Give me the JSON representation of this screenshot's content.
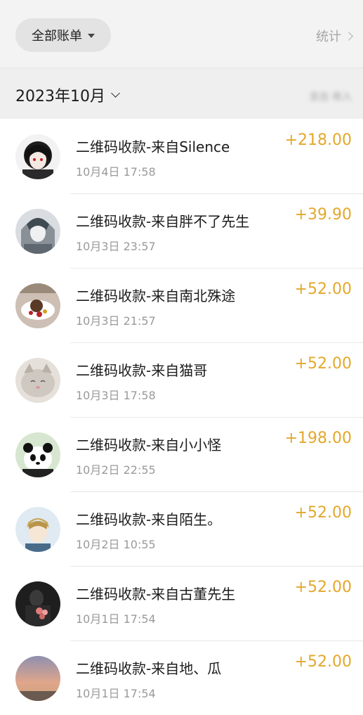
{
  "header": {
    "filter_label": "全部账单",
    "stats_label": "统计"
  },
  "month_bar": {
    "month_label": "2023年10月",
    "summary_text": "支出 收入"
  },
  "transactions": [
    {
      "title": "二维码收款-来自Silence",
      "time": "10月4日 17:58",
      "amount": "+218.00",
      "avatar": "anime-girl-avatar"
    },
    {
      "title": "二维码收款-来自胖不了先生",
      "time": "10月3日 23:57",
      "amount": "+39.90",
      "avatar": "anime-character-avatar"
    },
    {
      "title": "二维码收款-来自南北殊途",
      "time": "10月3日 21:57",
      "amount": "+52.00",
      "avatar": "dessert-plate-avatar"
    },
    {
      "title": "二维码收款-来自猫哥",
      "time": "10月3日 17:58",
      "amount": "+52.00",
      "avatar": "cat-avatar"
    },
    {
      "title": "二维码收款-来自小小怪",
      "time": "10月2日 22:55",
      "amount": "+198.00",
      "avatar": "panda-avatar"
    },
    {
      "title": "二维码收款-来自陌生。",
      "time": "10月2日 10:55",
      "amount": "+52.00",
      "avatar": "anime-boy-avatar"
    },
    {
      "title": "二维码收款-来自古董先生",
      "time": "10月1日 17:54",
      "amount": "+52.00",
      "avatar": "flowers-dark-avatar"
    },
    {
      "title": "二维码收款-来自地、瓜",
      "time": "10月1日 17:54",
      "amount": "+52.00",
      "avatar": "sunset-sky-avatar"
    }
  ],
  "colors": {
    "amount_income": "#e3a82b",
    "topbar_bg": "#f3f3f3"
  }
}
